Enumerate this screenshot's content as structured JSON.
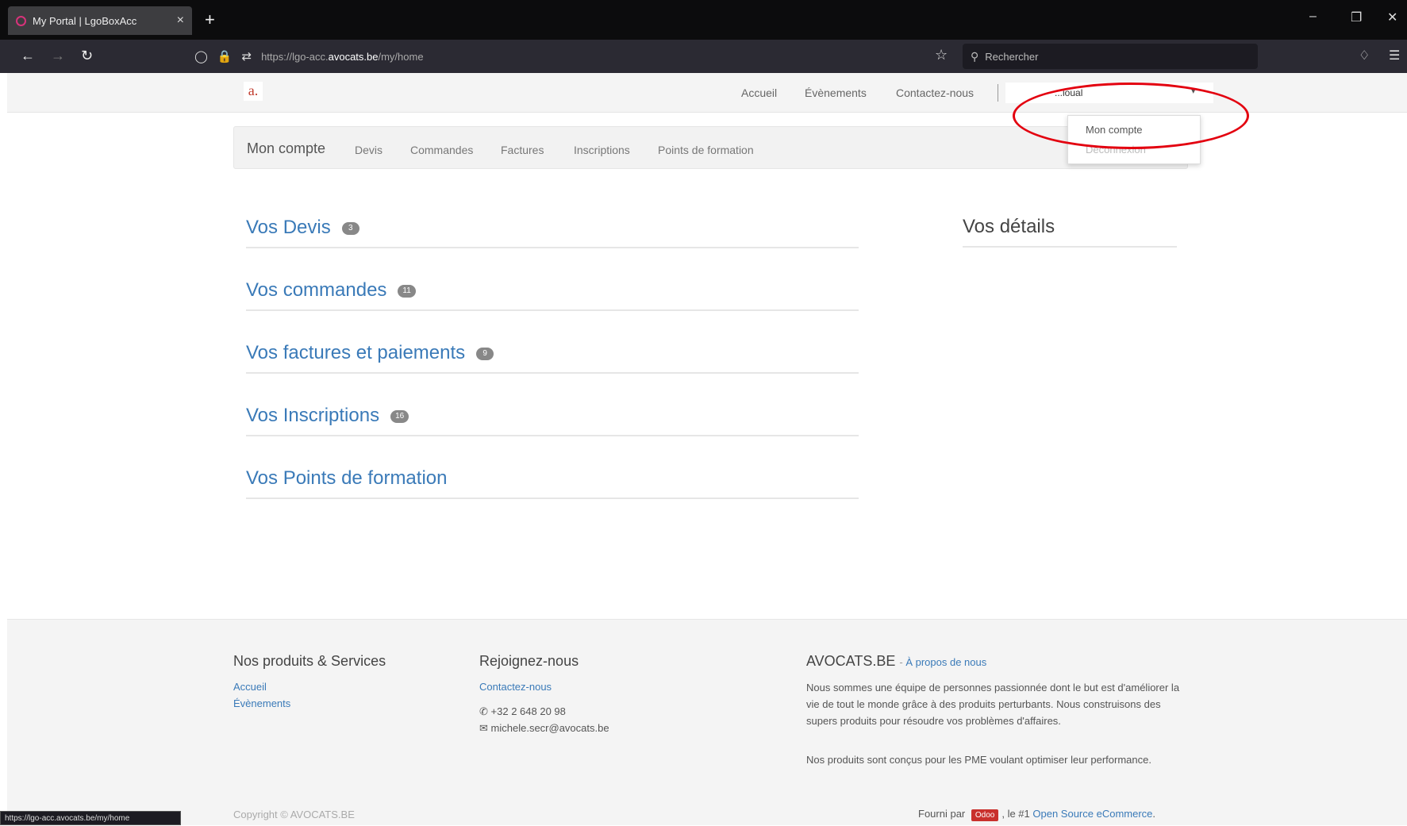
{
  "browser": {
    "tab_title": "My Portal | LgoBoxAcc",
    "tab_close": "×",
    "new_tab": "+",
    "url_prefix": "https://lgo-acc.",
    "url_domain": "avocats.be",
    "url_path": "/my/home",
    "search_placeholder": "Rechercher",
    "status_url": "https://lgo-acc.avocats.be/my/home"
  },
  "header": {
    "logo": "a.",
    "nav": [
      "Accueil",
      "Évènements",
      "Contactez-nous"
    ],
    "user_fragment": "...ioual",
    "user_caret": "▾"
  },
  "dropdown": {
    "items": [
      "Mon compte",
      "Déconnexion"
    ]
  },
  "breadcrumb": {
    "title": "Mon compte",
    "links": [
      "Devis",
      "Commandes",
      "Factures",
      "Inscriptions",
      "Points de formation"
    ]
  },
  "sections": [
    {
      "label": "Vos Devis",
      "count": "3"
    },
    {
      "label": "Vos commandes",
      "count": "11"
    },
    {
      "label": "Vos factures et paiements",
      "count": "9"
    },
    {
      "label": "Vos Inscriptions",
      "count": "16"
    },
    {
      "label": "Vos Points de formation",
      "count": ""
    }
  ],
  "details_title": "Vos détails",
  "footer": {
    "col1_title": "Nos produits & Services",
    "col1_links": [
      "Accueil",
      "Évènements"
    ],
    "col2_title": "Rejoignez-nous",
    "col2_link": "Contactez-nous",
    "phone": "+32 2 648 20 98",
    "email": "michele.secr@avocats.be",
    "col3_title": "AVOCATS.BE",
    "col3_about": "À propos de nous",
    "para1": "Nous sommes une équipe de personnes passionnée dont le but est d'améliorer la vie de tout le monde grâce à des produits perturbants. Nous construisons des supers produits pour résoudre vos problèmes d'affaires.",
    "para2": "Nos produits sont conçus pour les PME voulant optimiser leur performance.",
    "copyright": "Copyright © AVOCATS.BE",
    "powered_prefix": "Fourni par",
    "powered_badge": "Odoo",
    "powered_mid": ", le #1",
    "powered_link": "Open Source eCommerce",
    "powered_suffix": "."
  },
  "colors": {
    "link": "#3a7ab8",
    "annotation": "#e3000f",
    "badge": "#888888"
  }
}
